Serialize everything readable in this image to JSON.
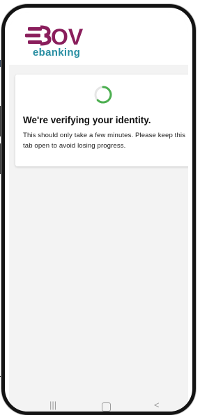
{
  "header": {
    "logo_text": "BOV",
    "logo_subtitle": "ebanking"
  },
  "status": {
    "title": "We're verifying your identity.",
    "message": "This should only take a few minutes. Please keep this tab open to avoid losing progress."
  },
  "navbar": {
    "recents_icon": "recent-apps-icon",
    "home_icon": "home-icon",
    "back_icon": "back-icon"
  },
  "colors": {
    "brand_purple": "#8a1e5c",
    "brand_teal": "#2a8fa3",
    "spinner_green": "#4caf50"
  }
}
